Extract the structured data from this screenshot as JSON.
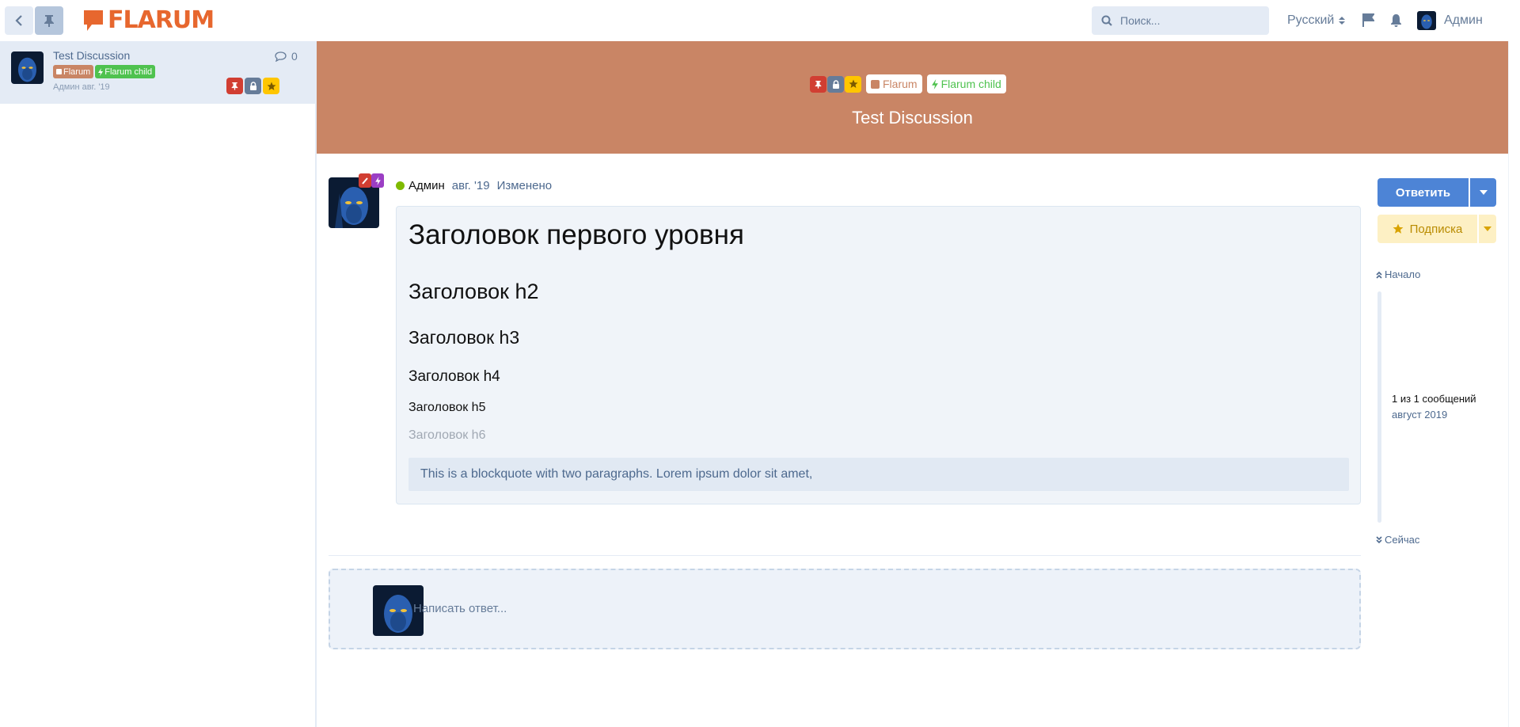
{
  "header": {
    "logo_text": "FLARUM",
    "search_placeholder": "Поиск...",
    "language": "Русский",
    "username": "Админ",
    "icons": [
      "back-icon",
      "pin-icon",
      "search-icon",
      "sort-icon",
      "flag-icon",
      "bell-icon"
    ]
  },
  "sidebar": {
    "items": [
      {
        "title": "Test Discussion",
        "replies": "0",
        "tags": [
          {
            "label": "Flarum",
            "color": "#c98565"
          },
          {
            "label": "Flarum child",
            "color": "#4fc24f"
          }
        ],
        "meta": "Админ авг. '19",
        "badges": [
          "pinned",
          "locked",
          "following"
        ]
      }
    ]
  },
  "discussion": {
    "title": "Test Discussion",
    "hero_color": "#c98565",
    "tags": [
      {
        "label": "Flarum",
        "color": "#c98565"
      },
      {
        "label": "Flarum child",
        "color": "#4fc24f"
      }
    ],
    "badges": [
      "pinned",
      "locked",
      "following"
    ]
  },
  "post": {
    "author": "Админ",
    "date": "авг. '19",
    "edited": "Изменено",
    "h1": "Заголовок первого уровня",
    "h2": "Заголовок h2",
    "h3": "Заголовок h3",
    "h4": "Заголовок h4",
    "h5": "Заголовок h5",
    "h6": "Заголовок h6",
    "blockquote": "This is a blockquote with two paragraphs. Lorem ipsum dolor sit amet,"
  },
  "reply": {
    "placeholder": "Написать ответ..."
  },
  "controls": {
    "reply_button": "Ответить",
    "follow_button": "Подписка",
    "scrub_start": "Начало",
    "scrub_now": "Сейчас",
    "scrub_position": "1 из 1 сообщений",
    "scrub_date": "август 2019"
  },
  "colors": {
    "accent": "#4d84d6",
    "brand": "#e7672e",
    "pinned": "#d13e32",
    "locked": "#667c99",
    "following": "#ffc600"
  }
}
